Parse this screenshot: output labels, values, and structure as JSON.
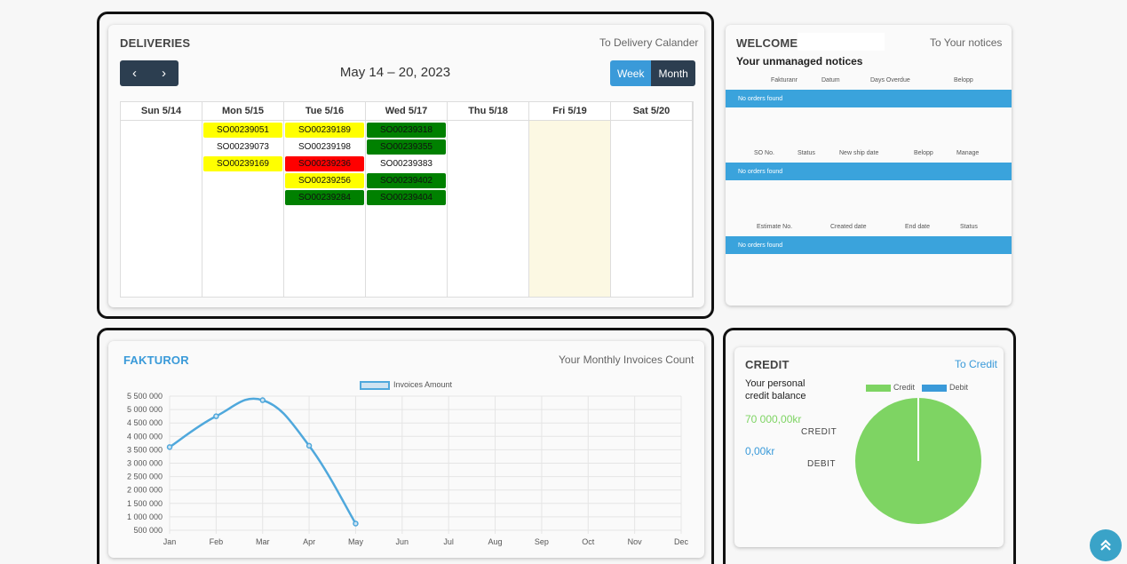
{
  "deliveries": {
    "title": "DELIVERIES",
    "link": "To Delivery Calander",
    "prev_icon": "‹",
    "next_icon": "›",
    "range": "May 14 – 20, 2023",
    "week_label": "Week",
    "month_label": "Month",
    "days": [
      {
        "label": "Sun 5/14",
        "today": false,
        "events": []
      },
      {
        "label": "Mon 5/15",
        "today": false,
        "events": [
          {
            "text": "SO00239051",
            "color": "yellow"
          },
          {
            "text": "SO00239073",
            "color": "white"
          },
          {
            "text": "SO00239169",
            "color": "yellow"
          }
        ]
      },
      {
        "label": "Tue 5/16",
        "today": false,
        "events": [
          {
            "text": "SO00239189",
            "color": "yellow"
          },
          {
            "text": "SO00239198",
            "color": "white"
          },
          {
            "text": "SO00239236",
            "color": "red"
          },
          {
            "text": "SO00239256",
            "color": "yellow"
          },
          {
            "text": "SO00239284",
            "color": "green"
          }
        ]
      },
      {
        "label": "Wed 5/17",
        "today": false,
        "events": [
          {
            "text": "SO00239318",
            "color": "green"
          },
          {
            "text": "SO00239355",
            "color": "green"
          },
          {
            "text": "SO00239383",
            "color": "white"
          },
          {
            "text": "SO00239402",
            "color": "green"
          },
          {
            "text": "SO00239404",
            "color": "green"
          }
        ]
      },
      {
        "label": "Thu 5/18",
        "today": false,
        "events": []
      },
      {
        "label": "Fri 5/19",
        "today": true,
        "events": []
      },
      {
        "label": "Sat 5/20",
        "today": false,
        "events": []
      }
    ]
  },
  "welcome": {
    "title": "WELCOME",
    "link": "To Your notices",
    "subtitle": "Your unmanaged notices",
    "tables": [
      {
        "columns": [
          "Fakturanr",
          "Datum",
          "Days Overdue",
          "Belopp"
        ],
        "empty": "No orders found"
      },
      {
        "columns": [
          "SO No.",
          "Status",
          "New ship date",
          "Belopp",
          "Manage"
        ],
        "empty": "No orders found"
      },
      {
        "columns": [
          "Estimate No.",
          "Created date",
          "End date",
          "Status"
        ],
        "empty": "No orders found"
      }
    ]
  },
  "fakturor": {
    "title": "FAKTUROR",
    "link": "Your Monthly Invoices Count",
    "legend": "Invoices Amount",
    "accent": "#3a9ad9"
  },
  "credit": {
    "title": "CREDIT",
    "link": "To Credit",
    "balance_label": "Your personal credit balance",
    "credit_value": "70 000,00kr",
    "credit_label": "CREDIT",
    "debit_value": "0,00kr",
    "debit_label": "DEBIT",
    "legend_credit": "Credit",
    "legend_debit": "Debit",
    "credit_color": "#7ed463",
    "debit_color": "#3a9ad9"
  },
  "scroll_top_icon": "double-chevron-up-icon",
  "chart_data": [
    {
      "type": "line",
      "title": "",
      "series": [
        {
          "name": "Invoices Amount",
          "values": [
            3600000,
            4750000,
            5350000,
            3650000,
            750000,
            null,
            null,
            null,
            null,
            null,
            null,
            null
          ]
        }
      ],
      "categories": [
        "Jan",
        "Feb",
        "Mar",
        "Apr",
        "May",
        "Jun",
        "Jul",
        "Aug",
        "Sep",
        "Oct",
        "Nov",
        "Dec"
      ],
      "yticks": [
        "500 000",
        "1 000 000",
        "1 500 000",
        "2 000 000",
        "2 500 000",
        "3 000 000",
        "3 500 000",
        "4 000 000",
        "4 500 000",
        "5 000 000",
        "5 500 000"
      ],
      "ylim": [
        500000,
        5500000
      ],
      "grid": true,
      "legend_position": "top"
    },
    {
      "type": "pie",
      "categories": [
        "Credit",
        "Debit"
      ],
      "values": [
        70000,
        0
      ],
      "legend_position": "top"
    }
  ]
}
